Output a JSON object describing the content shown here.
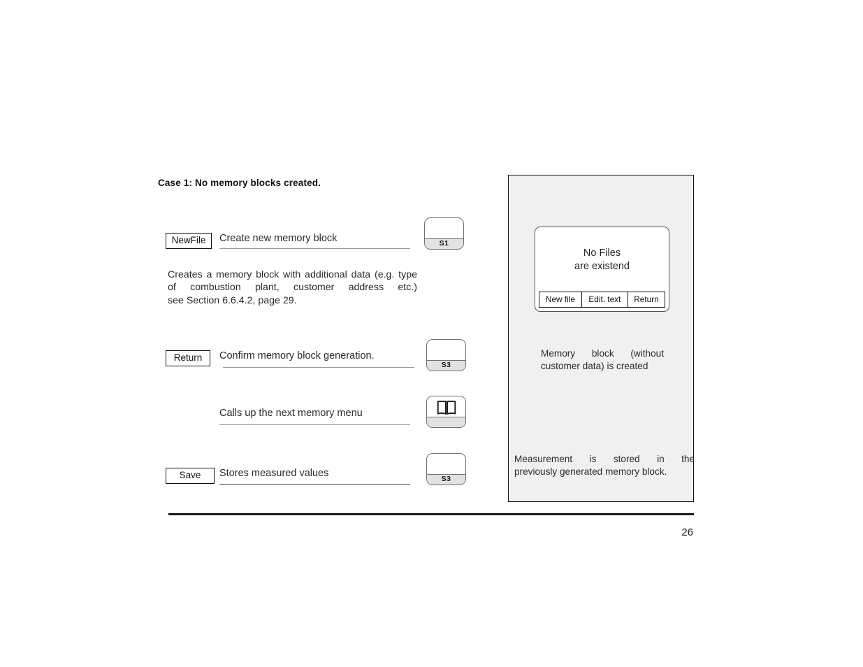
{
  "document": {
    "heading": "Case 1: No memory blocks created.",
    "page_number": "26"
  },
  "steps": [
    {
      "key_label": "NewFile",
      "text": "Create new memory block",
      "hardware_key": "S1"
    },
    {
      "key_label": "Return",
      "text": "Confirm memory block generation.",
      "hardware_key": "S3"
    },
    {
      "key_label": "",
      "text": "Calls up the next memory menu",
      "hardware_key": "book-icon"
    },
    {
      "key_label": "Save",
      "text": "Stores measured values",
      "hardware_key": "S3"
    }
  ],
  "description": {
    "line1": "Creates a memory block with additional data (e.g.",
    "line2": "type of combustion plant, customer address etc.)",
    "line3": "see Section 6.6.4.2, page 29."
  },
  "display_panel": {
    "lcd": {
      "line1": "No Files",
      "line2": "are existend",
      "softkeys": [
        "New file",
        "Edit. text",
        "Return"
      ]
    },
    "note_created": {
      "line1": "Memory block (without",
      "line2": "customer data) is created"
    },
    "note_stored": {
      "line1": "Measurement is stored in the",
      "line2": "previously generated memory block."
    }
  },
  "colors": {
    "panel_background": "#f0f0f0",
    "key_band": "#e2e2e2",
    "rule": "#9a9a9a",
    "text": "#2a2a2a"
  }
}
